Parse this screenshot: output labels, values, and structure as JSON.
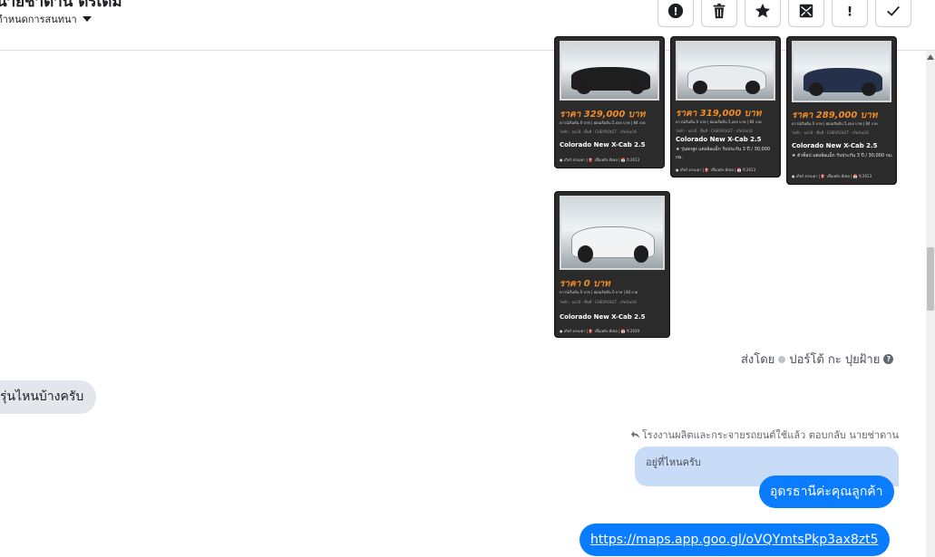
{
  "header": {
    "title": "นายช่าดาน ดรเดม",
    "subtitle": "กำหนดการสนทนา",
    "toolbar": [
      "spam",
      "delete",
      "star",
      "mark-unread",
      "important",
      "done"
    ],
    "toolbar_symbols": {
      "spam": "!",
      "important": "!"
    }
  },
  "cards": [
    {
      "price": "ราคา 329,000 บาท",
      "specs": "ดาวน์เริ่มต้น 0 บาท | ผ่อนเริ่มต้น 5,xxx บาท | 84 งวด",
      "tags": "ไฟฟ้า · ออโต้ · พื้นที่ · CHEVROLET · เกียร์ออโต้",
      "model": "Colorado New X-Cab 2.5",
      "note": "",
      "meta": "● เกียร์ ธรรมดา | ⛽ เชื้อเพลิง ดีเซล | 📅 ปี 2013"
    },
    {
      "price": "ราคา 319,000 บาท",
      "specs": "ดาวน์เริ่มต้น 0 บาท | ผ่อนเริ่มต้น 5,xxx บาท | 84 งวด",
      "tags": "ไฟฟ้า · ออโต้ · พื้นที่ · CHEVROLET · เกียร์ออโต้",
      "model": "Colorado New X-Cab 2.5",
      "note": "★ รุ่นยกสูง แต่งล้อแม็ก รับประกัน 3 ปี / 30,000 กม.",
      "meta": "● เกียร์ ธรรมดา | ⛽ เชื้อเพลิง ดีเซล | 📅 ปี 2013"
    },
    {
      "price": "ราคา 289,000 บาท",
      "specs": "ดาวน์เริ่มต้น 0 บาท | ผ่อนเริ่มต้น 5,xxx บาท | 84 งวด",
      "tags": "ไฟฟ้า · ออโต้ · พื้นที่ · CHEVROLET · เกียร์ออโต้",
      "model": "Colorado New X-Cab 2.5",
      "note": "★ ตัวท็อป แต่งล้อแม็ก รับประกัน 3 ปี / 30,000 กม.",
      "meta": "● เกียร์ ธรรมดา | ⛽ เชื้อเพลิง ดีเซล | 📅 ปี 2013"
    },
    {
      "price": "ราคา 0 บาท",
      "specs": "ดาวน์เริ่มต้น 0 บาท | ผ่อนเริ่มต้น 0 บาท | 84 งวด",
      "tags": "ไฟฟ้า · ออโต้ · พื้นที่ · CHEVROLET · เกียร์ออโต้",
      "model": "Colorado New X-Cab 2.5",
      "note": "",
      "meta": "● เกียร์ ธรรมดา | ⛽ เชื้อเพลิง ดีเซล | 📅 ปี 2019"
    }
  ],
  "sent_by": {
    "prefix": "ส่งโดย",
    "name": "ปอร์โต้ กะ ปุยฝ้าย"
  },
  "messages": {
    "incoming": "รุ่นไหนบ้างครับ",
    "reply_note": "โรงงานผลิตและกระจายรถยนต์ใช้แล้ว ตอบกลับ นายช่าดาน",
    "quoted": "อยู่ที่ไหนครับ",
    "outgoing_1": "อุดรธานีค่ะคุณลูกค้า",
    "outgoing_link": "https://maps.app.goo.gl/oVQYmtsPkp3ax8zt5"
  },
  "colors": {
    "accent": "#0a7cff",
    "quote": "#c9dcf7",
    "price": "#f28c28",
    "card": "#2b2b2b"
  }
}
